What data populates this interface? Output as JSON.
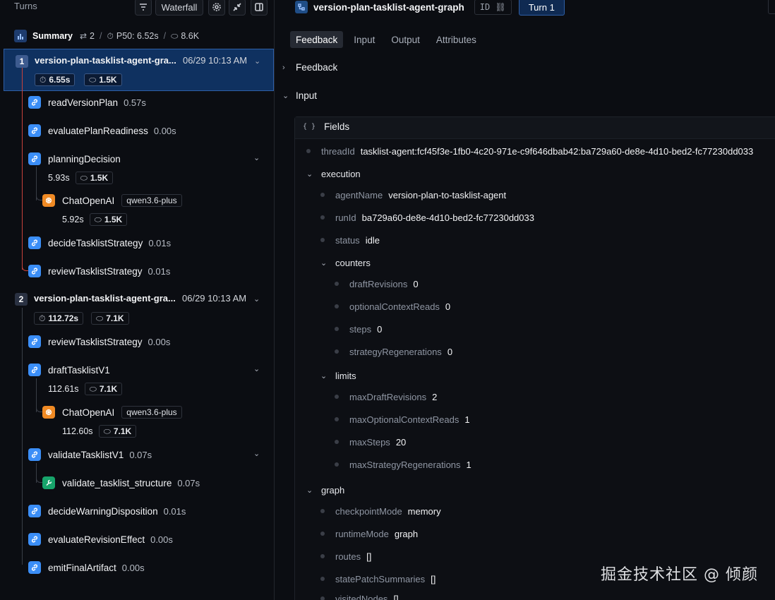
{
  "left": {
    "title": "Turns",
    "toolbar": {
      "waterfall": "Waterfall"
    },
    "summary": {
      "label": "Summary",
      "turns": "2",
      "p50": "P50: 6.52s",
      "tokens": "8.6K"
    },
    "turns": [
      {
        "num": "1",
        "name": "version-plan-tasklist-agent-gra...",
        "time": "06/29 10:13 AM",
        "duration": "6.55s",
        "tokens": "1.5K",
        "nodes": [
          {
            "name": "readVersionPlan",
            "dur": "0.57s"
          },
          {
            "name": "evaluatePlanReadiness",
            "dur": "0.00s"
          },
          {
            "name": "planningDecision",
            "sub_dur": "5.93s",
            "sub_tokens": "1.5K",
            "child": {
              "name": "ChatOpenAI",
              "model": "qwen3.6-plus",
              "sub_dur": "5.92s",
              "sub_tokens": "1.5K"
            }
          },
          {
            "name": "decideTasklistStrategy",
            "dur": "0.01s"
          },
          {
            "name": "reviewTasklistStrategy",
            "dur": "0.01s"
          }
        ]
      },
      {
        "num": "2",
        "name": "version-plan-tasklist-agent-gra...",
        "time": "06/29 10:13 AM",
        "duration": "112.72s",
        "tokens": "7.1K",
        "nodes": [
          {
            "name": "reviewTasklistStrategy",
            "dur": "0.00s"
          },
          {
            "name": "draftTasklistV1",
            "sub_dur": "112.61s",
            "sub_tokens": "7.1K",
            "child": {
              "name": "ChatOpenAI",
              "model": "qwen3.6-plus",
              "sub_dur": "112.60s",
              "sub_tokens": "7.1K"
            }
          },
          {
            "name": "validateTasklistV1",
            "dur": "0.07s",
            "child": {
              "name": "validate_tasklist_structure",
              "dur": "0.07s"
            }
          },
          {
            "name": "decideWarningDisposition",
            "dur": "0.01s"
          },
          {
            "name": "evaluateRevisionEffect",
            "dur": "0.00s"
          },
          {
            "name": "emitFinalArtifact",
            "dur": "0.00s"
          }
        ]
      }
    ]
  },
  "right": {
    "title": "version-plan-tasklist-agent-graph",
    "id_label": "ID",
    "turn_label": "Turn 1",
    "tabs": [
      "Feedback",
      "Input",
      "Output",
      "Attributes"
    ],
    "sections": {
      "feedback": "Feedback",
      "input": "Input",
      "fields": "Fields"
    },
    "fields": {
      "threadId": {
        "k": "threadId",
        "v": "tasklist-agent:fcf45f3e-1fb0-4c20-971e-c9f646dbab42:ba729a60-de8e-4d10-bed2-fc77230dd033"
      },
      "execution": "execution",
      "agentName": {
        "k": "agentName",
        "v": "version-plan-to-tasklist-agent"
      },
      "runId": {
        "k": "runId",
        "v": "ba729a60-de8e-4d10-bed2-fc77230dd033"
      },
      "status": {
        "k": "status",
        "v": "idle"
      },
      "counters": "counters",
      "draftRevisions": {
        "k": "draftRevisions",
        "v": "0"
      },
      "optionalContextReads": {
        "k": "optionalContextReads",
        "v": "0"
      },
      "steps": {
        "k": "steps",
        "v": "0"
      },
      "strategyRegenerations": {
        "k": "strategyRegenerations",
        "v": "0"
      },
      "limits": "limits",
      "maxDraftRevisions": {
        "k": "maxDraftRevisions",
        "v": "2"
      },
      "maxOptionalContextReads": {
        "k": "maxOptionalContextReads",
        "v": "1"
      },
      "maxSteps": {
        "k": "maxSteps",
        "v": "20"
      },
      "maxStrategyRegenerations": {
        "k": "maxStrategyRegenerations",
        "v": "1"
      },
      "graph": "graph",
      "checkpointMode": {
        "k": "checkpointMode",
        "v": "memory"
      },
      "runtimeMode": {
        "k": "runtimeMode",
        "v": "graph"
      },
      "routes": {
        "k": "routes",
        "v": "[]"
      },
      "statePatchSummaries": {
        "k": "statePatchSummaries",
        "v": "[]"
      },
      "visitedNodes": {
        "k": "visitedNodes",
        "v": "[]"
      }
    }
  },
  "watermark": "掘金技术社区 @ 倾颜",
  "colors": {
    "accent": "#3b8ef7",
    "selected_bg": "#0f3160",
    "trace_line": "#c9423b",
    "openai": "#f08a24",
    "tool": "#17a46b"
  }
}
